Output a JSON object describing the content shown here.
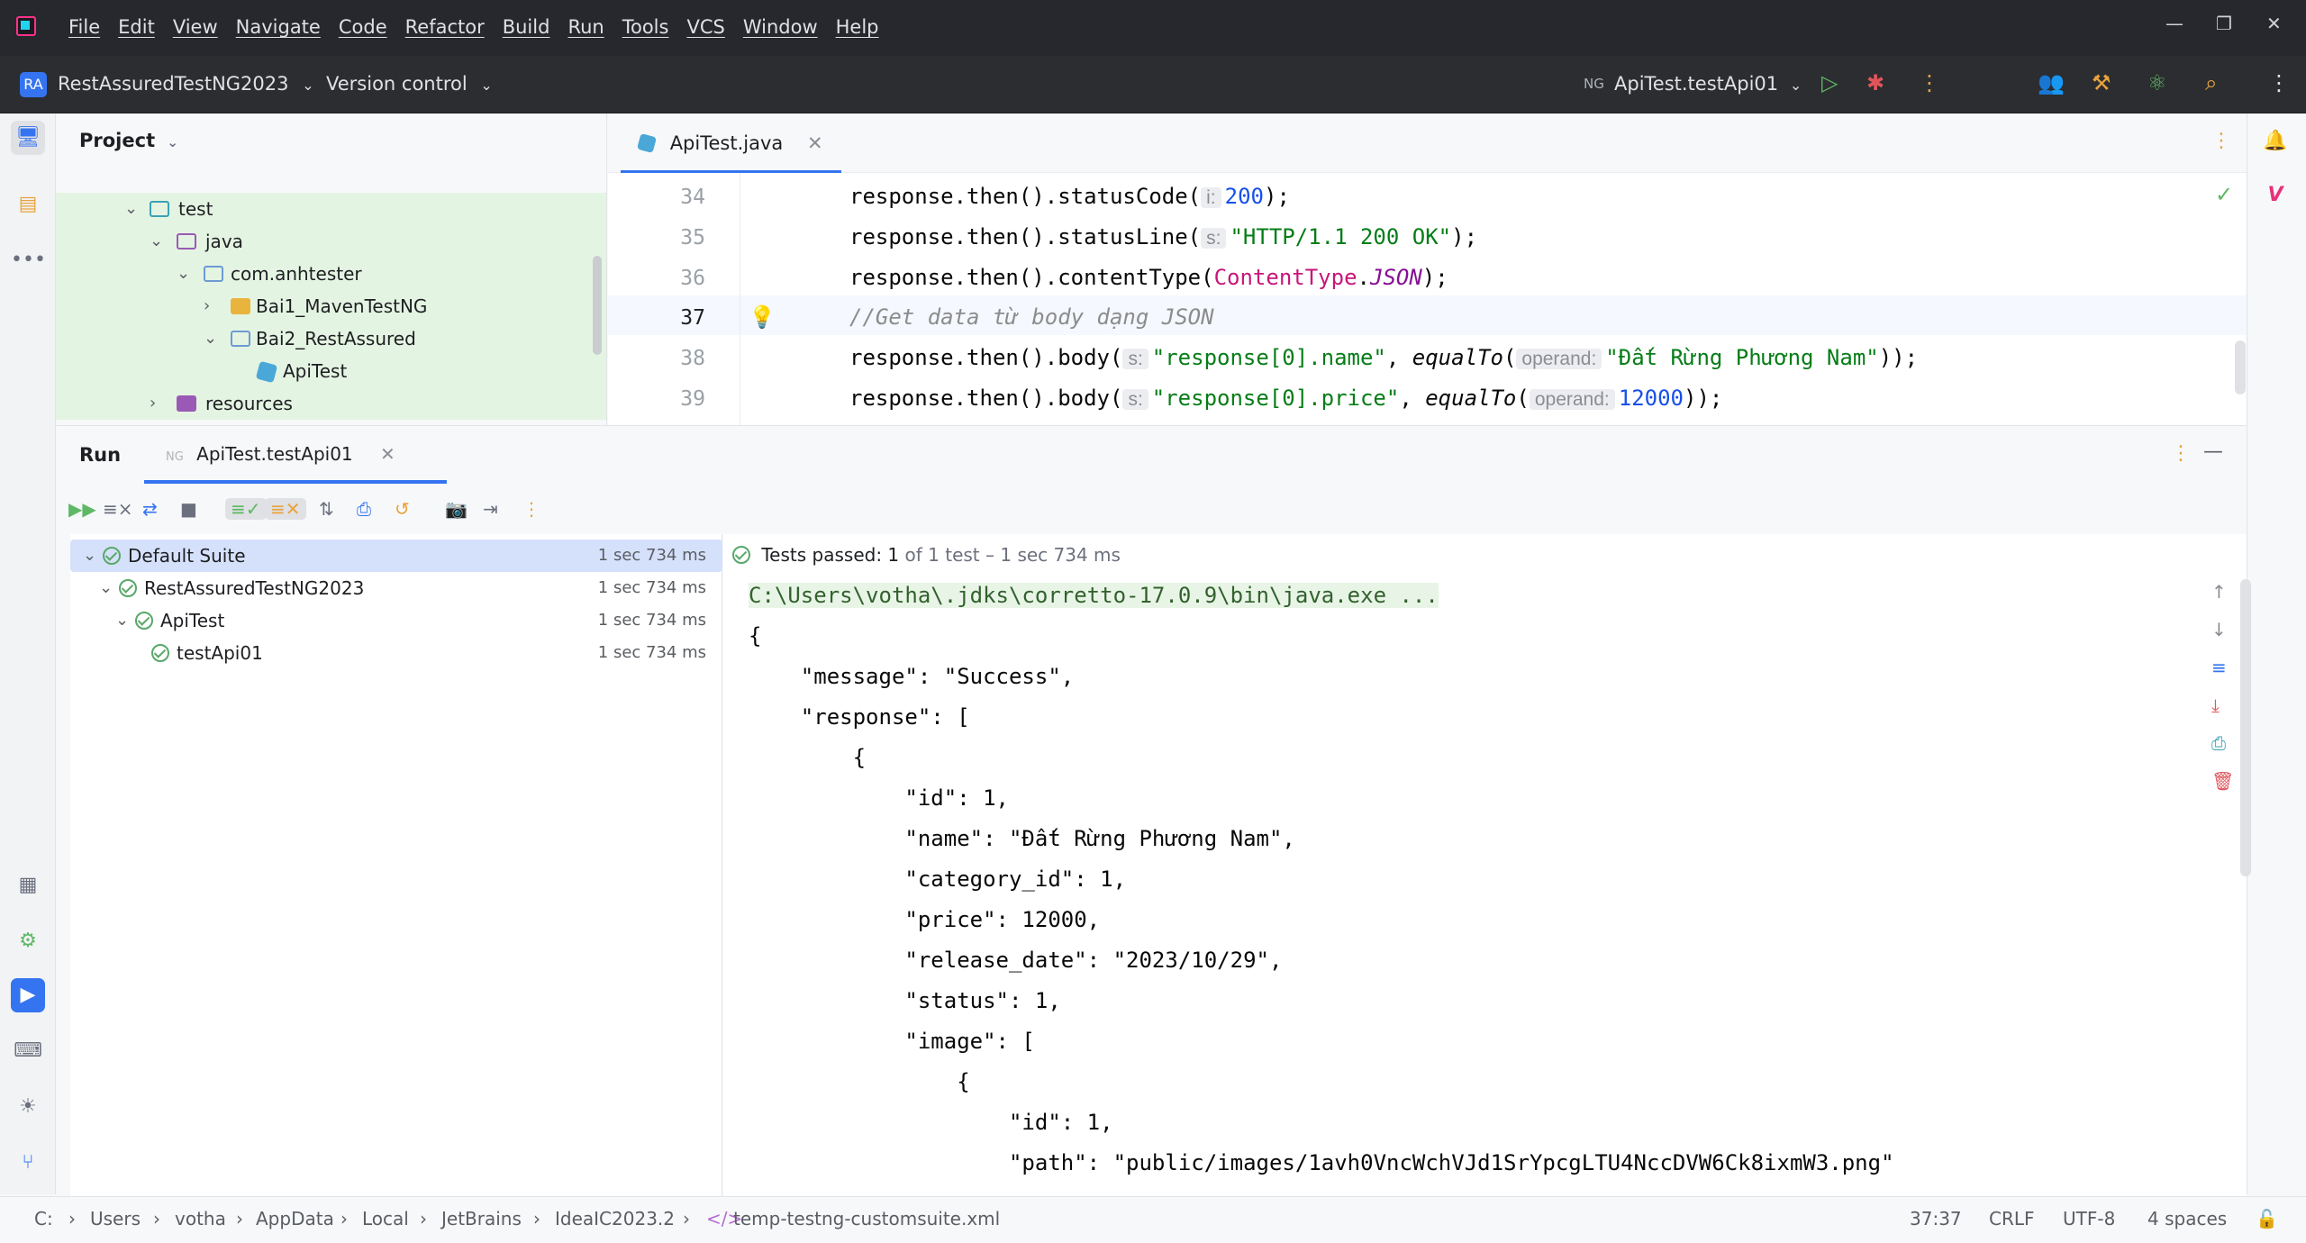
{
  "menu": [
    "File",
    "Edit",
    "View",
    "Navigate",
    "Code",
    "Refactor",
    "Build",
    "Run",
    "Tools",
    "VCS",
    "Window",
    "Help"
  ],
  "toolbar": {
    "project_badge": "RA",
    "project_name": "RestAssuredTestNG2023",
    "version_control": "Version control",
    "run_config": "ApiTest.testApi01"
  },
  "project_panel": {
    "title": "Project",
    "items": [
      {
        "label": "test",
        "indent": 1
      },
      {
        "label": "java",
        "indent": 2
      },
      {
        "label": "com.anhtester",
        "indent": 3
      },
      {
        "label": "Bai1_MavenTestNG",
        "indent": 4
      },
      {
        "label": "Bai2_RestAssured",
        "indent": 4
      },
      {
        "label": "ApiTest",
        "indent": 5
      },
      {
        "label": "resources",
        "indent": 2
      }
    ]
  },
  "editor": {
    "tab": "ApiTest.java",
    "lines": [
      {
        "n": "34"
      },
      {
        "n": "35"
      },
      {
        "n": "36"
      },
      {
        "n": "37"
      },
      {
        "n": "38"
      },
      {
        "n": "39"
      }
    ],
    "code": {
      "l34a": "response.then().statusCode(",
      "l34h": "i:",
      "l34v": "200",
      "l34e": ");",
      "l35a": "response.then().statusLine(",
      "l35h": "s:",
      "l35v": "\"HTTP/1.1 200 OK\"",
      "l35e": ");",
      "l36a": "response.then().contentType(",
      "l36c": "ContentType",
      "l36d": ".",
      "l36f": "JSON",
      "l36e": ");",
      "l37": "//Get data từ body dạng JSON",
      "l38a": "response.then().body(",
      "l38h": "s:",
      "l38v": "\"response[0].name\"",
      "l38b": ", ",
      "l38m": "equalTo",
      "l38p": "(",
      "l38h2": "operand:",
      "l38v2": "\"Đất Rừng Phương Nam\"",
      "l38e": "));",
      "l39a": "response.then().body(",
      "l39h": "s:",
      "l39v": "\"response[0].price\"",
      "l39b": ", ",
      "l39m": "equalTo",
      "l39p": "(",
      "l39h2": "operand:",
      "l39v2": "12000",
      "l39e": "));"
    }
  },
  "run": {
    "label": "Run",
    "tab": "ApiTest.testApi01",
    "tests_passed_label": "Tests passed:",
    "tests_passed_count": "1",
    "tests_passed_rest": "of 1 test – 1 sec 734 ms",
    "tree": [
      {
        "label": "Default Suite",
        "time": "1 sec 734 ms"
      },
      {
        "label": "RestAssuredTestNG2023",
        "time": "1 sec 734 ms"
      },
      {
        "label": "ApiTest",
        "time": "1 sec 734 ms"
      },
      {
        "label": "testApi01",
        "time": "1 sec 734 ms"
      }
    ],
    "console": [
      "C:\\Users\\votha\\.jdks\\corretto-17.0.9\\bin\\java.exe ...",
      "{",
      "    \"message\": \"Success\",",
      "    \"response\": [",
      "        {",
      "            \"id\": 1,",
      "            \"name\": \"Đất Rừng Phương Nam\",",
      "            \"category_id\": 1,",
      "            \"price\": 12000,",
      "            \"release_date\": \"2023/10/29\",",
      "            \"status\": 1,",
      "            \"image\": [",
      "                {",
      "                    \"id\": 1,",
      "                    \"path\": \"public/images/1avh0VncWchVJd1SrYpcgLTU4NccDVW6Ck8ixmW3.png\""
    ]
  },
  "statusbar": {
    "crumbs": [
      "C:",
      "Users",
      "votha",
      "AppData",
      "Local",
      "JetBrains",
      "IdeaIC2023.2",
      "temp-testng-customsuite.xml"
    ],
    "position": "37:37",
    "line_sep": "CRLF",
    "encoding": "UTF-8",
    "indent": "4 spaces"
  },
  "colors": {
    "accent": "#3574f0",
    "pass": "#59a869",
    "titlebar": "#27282e"
  }
}
